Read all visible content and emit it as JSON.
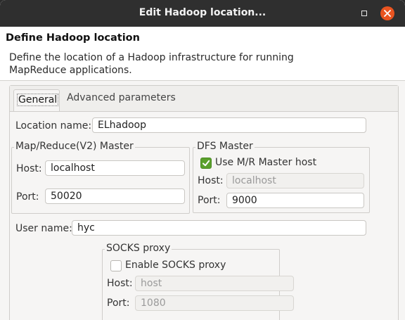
{
  "window": {
    "title": "Edit Hadoop location..."
  },
  "header": {
    "title": "Define Hadoop location",
    "description": "Define the location of a Hadoop infrastructure for running MapReduce applications."
  },
  "tabs": {
    "general": "General",
    "advanced": "Advanced parameters"
  },
  "general": {
    "location_name_label": "Location name:",
    "location_name_value": "ELhadoop",
    "mr_master": {
      "title": "Map/Reduce(V2) Master",
      "host_label": "Host:",
      "host_value": "localhost",
      "port_label": "Port:",
      "port_value": "50020"
    },
    "dfs_master": {
      "title": "DFS Master",
      "use_mr_host_label": "Use M/R Master host",
      "use_mr_host_checked": true,
      "host_label": "Host:",
      "host_value": "localhost",
      "port_label": "Port:",
      "port_value": "9000"
    },
    "user_name_label": "User name:",
    "user_name_value": "hyc",
    "socks_proxy": {
      "title": "SOCKS proxy",
      "enable_label": "Enable SOCKS proxy",
      "enable_checked": false,
      "host_label": "Host:",
      "host_value": "host",
      "port_label": "Port:",
      "port_value": "1080"
    }
  },
  "colors": {
    "titlebar": "#2f2f2f",
    "close_button": "#e95420",
    "checkbox_checked": "#5aa02c"
  }
}
